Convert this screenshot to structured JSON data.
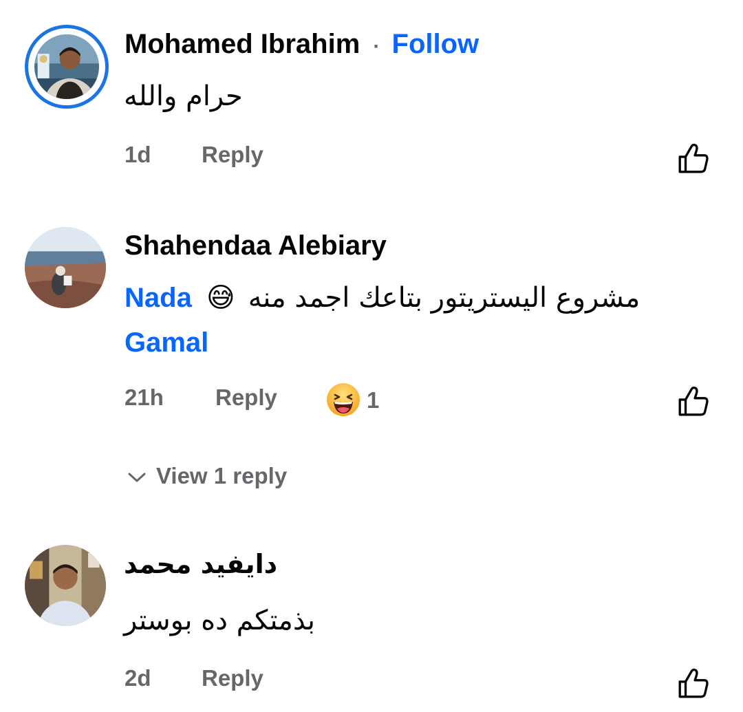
{
  "comments": [
    {
      "author": "Mohamed Ibrahim",
      "follow_separator": "·",
      "follow_label": "Follow",
      "text": "حرام والله",
      "time": "1d",
      "reply_label": "Reply",
      "like_icon": "thumbs-up-icon"
    },
    {
      "author": "Shahendaa Alebiary",
      "text": "مشروع اليستريتور بتاعك اجمد منه",
      "emoji": "😅",
      "mention_first": "Nada",
      "mention_second": "Gamal",
      "time": "21h",
      "reply_label": "Reply",
      "reaction_icon": "haha-reaction-icon",
      "reaction_count": "1",
      "view_replies_label": "View 1 reply",
      "like_icon": "thumbs-up-icon"
    },
    {
      "author": "دايفيد محمد",
      "text": "بذمتكم ده بوستر",
      "time": "2d",
      "reply_label": "Reply",
      "like_icon": "thumbs-up-icon"
    }
  ],
  "colors": {
    "link": "#0866ff",
    "meta": "#65676b",
    "story_ring": "#1b74e4",
    "text": "#050505"
  }
}
